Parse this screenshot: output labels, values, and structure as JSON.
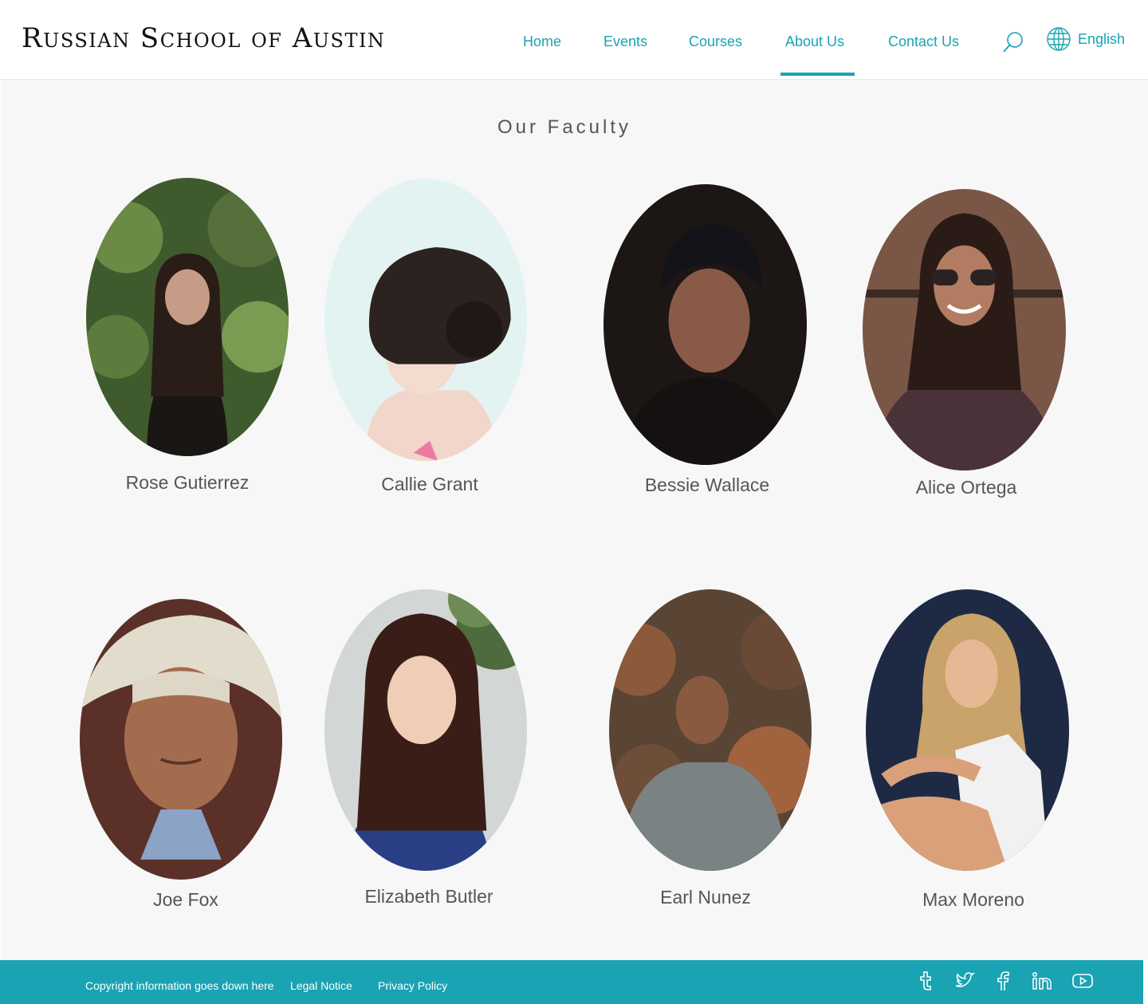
{
  "site": {
    "logo": "Russian School of Austin"
  },
  "nav": {
    "items": [
      {
        "label": "Home"
      },
      {
        "label": "Events"
      },
      {
        "label": "Courses"
      },
      {
        "label": "About Us",
        "active": true
      },
      {
        "label": "Contact Us"
      }
    ],
    "language": "English"
  },
  "page": {
    "title": "Our Faculty"
  },
  "faculty": [
    {
      "name": "Rose Gutierrez"
    },
    {
      "name": "Callie Grant"
    },
    {
      "name": "Bessie Wallace"
    },
    {
      "name": "Alice Ortega"
    },
    {
      "name": "Joe Fox"
    },
    {
      "name": "Elizabeth Butler"
    },
    {
      "name": "Earl Nunez"
    },
    {
      "name": "Max Moreno"
    }
  ],
  "footer": {
    "copyright": "Copyright information goes down here",
    "legal": "Legal Notice",
    "privacy": "Privacy Policy",
    "social": [
      "tumblr-icon",
      "twitter-icon",
      "facebook-icon",
      "linkedin-icon",
      "youtube-icon"
    ]
  },
  "colors": {
    "accent": "#1aa3b3",
    "background": "#f7f7f7",
    "text": "#555555"
  }
}
